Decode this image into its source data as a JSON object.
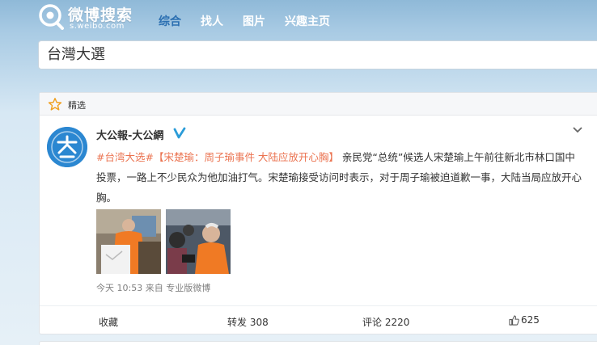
{
  "header": {
    "logo_title": "微博搜索",
    "logo_sub": "s.weibo.com",
    "nav": [
      {
        "label": "综合",
        "active": true
      },
      {
        "label": "找人"
      },
      {
        "label": "图片"
      },
      {
        "label": "兴趣主页"
      }
    ]
  },
  "search": {
    "query": "台灣大選"
  },
  "card": {
    "section_label": "精选",
    "user_name": "大公報-大公網",
    "avatar_text": "大公",
    "post": {
      "hashtag": "#台湾大选#",
      "headline": "【宋楚瑜：周子瑜事件 大陆应放开心胸】",
      "body_1": "亲民党“总统”候选人宋楚瑜上午前往新北市林口国中投票，一路上不少民众为他加油打气。宋楚瑜接受访问时表示，对于周子瑜被迫道歉一事，大陆当局应放开心胸。"
    },
    "meta": {
      "time": "今天 10:53",
      "from": "来自",
      "source": "专业版微博"
    },
    "actions": {
      "fav": "收藏",
      "forward": "转发 308",
      "comment": "评论 2220",
      "like": "625"
    }
  },
  "colors": {
    "accent": "#eb7350",
    "nav_active": "#2b6fb1",
    "avatar_bg": "#2b87d1"
  }
}
